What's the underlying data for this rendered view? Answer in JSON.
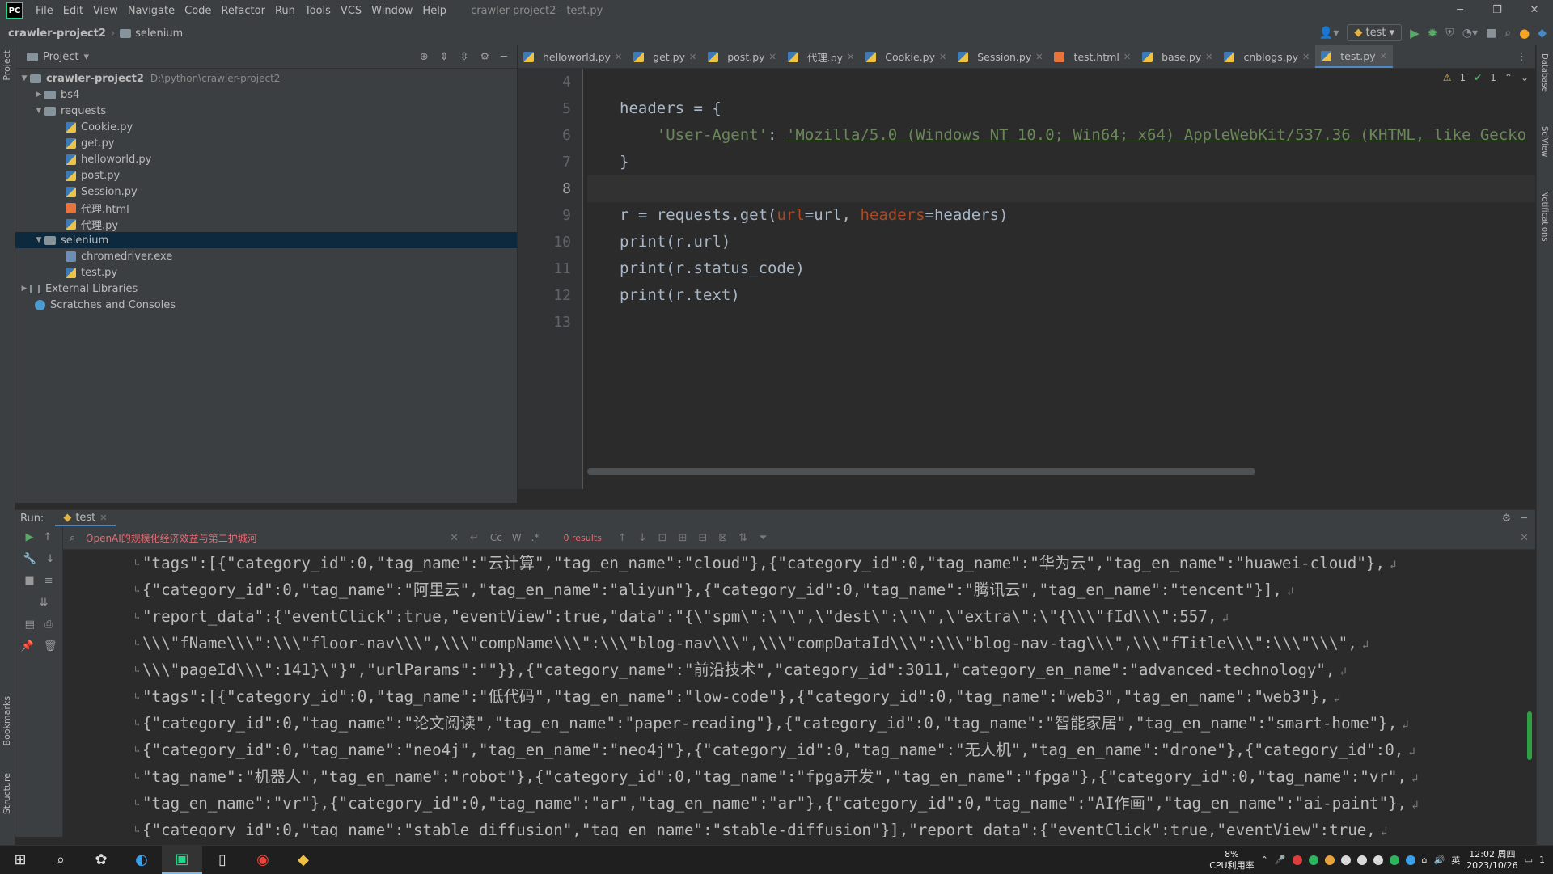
{
  "menubar": {
    "logo": "PC",
    "items": [
      "File",
      "Edit",
      "View",
      "Navigate",
      "Code",
      "Refactor",
      "Run",
      "Tools",
      "VCS",
      "Window",
      "Help"
    ],
    "window_title": "crawler-project2 - test.py"
  },
  "navbar": {
    "project": "crawler-project2",
    "folder": "selenium",
    "run_config": "test"
  },
  "project_panel": {
    "title": "Project",
    "root": "crawler-project2",
    "root_path": "D:\\python\\crawler-project2",
    "bs4": "bs4",
    "requests": "requests",
    "requests_files": [
      "Cookie.py",
      "get.py",
      "helloworld.py",
      "post.py",
      "Session.py",
      "代理.html",
      "代理.py"
    ],
    "selenium": "selenium",
    "selenium_files": [
      "chromedriver.exe",
      "test.py"
    ],
    "external": "External Libraries",
    "scratches": "Scratches and Consoles"
  },
  "tabs": [
    "helloworld.py",
    "get.py",
    "post.py",
    "代理.py",
    "Cookie.py",
    "Session.py",
    "test.html",
    "base.py",
    "cnblogs.py",
    "test.py"
  ],
  "editor": {
    "inspections": {
      "warnings": "1",
      "ok": "1"
    },
    "line_numbers": [
      "4",
      "5",
      "6",
      "7",
      "8",
      "9",
      "10",
      "11",
      "12",
      "13"
    ],
    "line5": "headers = {",
    "line6_key": "'User-Agent'",
    "line6_colon": ": ",
    "line6_val": "'Mozilla/5.0 (Windows NT 10.0; Win64; x64) AppleWebKit/537.36 (KHTML, like Gecko",
    "line7": "}",
    "line9_a": "r = requests.get(",
    "line9_url_kw": "url",
    "line9_b": "=url, ",
    "line9_headers_kw": "headers",
    "line9_c": "=headers)",
    "line10": "print(r.url)",
    "line11": "print(r.status_code)",
    "line12": "print(r.text)"
  },
  "run": {
    "label": "Run:",
    "tab": "test",
    "search_query": "OpenAI的规模化经济效益与第二护城河",
    "search_opts": [
      "Cc",
      "W",
      ".*"
    ],
    "results": "0 results",
    "output": [
      "\"tags\":[{\"category_id\":0,\"tag_name\":\"云计算\",\"tag_en_name\":\"cloud\"},{\"category_id\":0,\"tag_name\":\"华为云\",\"tag_en_name\":\"huawei-cloud\"},",
      "{\"category_id\":0,\"tag_name\":\"阿里云\",\"tag_en_name\":\"aliyun\"},{\"category_id\":0,\"tag_name\":\"腾讯云\",\"tag_en_name\":\"tencent\"}],",
      "\"report_data\":{\"eventClick\":true,\"eventView\":true,\"data\":\"{\\\"spm\\\":\\\"\\\",\\\"dest\\\":\\\"\\\",\\\"extra\\\":\\\"{\\\\\\\"fId\\\\\\\":557,",
      "\\\\\\\"fName\\\\\\\":\\\\\\\"floor-nav\\\\\\\",\\\\\\\"compName\\\\\\\":\\\\\\\"blog-nav\\\\\\\",\\\\\\\"compDataId\\\\\\\":\\\\\\\"blog-nav-tag\\\\\\\",\\\\\\\"fTitle\\\\\\\":\\\\\\\"\\\\\\\",",
      "\\\\\\\"pageId\\\\\\\":141}\\\"}\",\"urlParams\":\"\"}},{\"category_name\":\"前沿技术\",\"category_id\":3011,\"category_en_name\":\"advanced-technology\",",
      "\"tags\":[{\"category_id\":0,\"tag_name\":\"低代码\",\"tag_en_name\":\"low-code\"},{\"category_id\":0,\"tag_name\":\"web3\",\"tag_en_name\":\"web3\"},",
      "{\"category_id\":0,\"tag_name\":\"论文阅读\",\"tag_en_name\":\"paper-reading\"},{\"category_id\":0,\"tag_name\":\"智能家居\",\"tag_en_name\":\"smart-home\"},",
      "{\"category_id\":0,\"tag_name\":\"neo4j\",\"tag_en_name\":\"neo4j\"},{\"category_id\":0,\"tag_name\":\"无人机\",\"tag_en_name\":\"drone\"},{\"category_id\":0,",
      "\"tag_name\":\"机器人\",\"tag_en_name\":\"robot\"},{\"category_id\":0,\"tag_name\":\"fpga开发\",\"tag_en_name\":\"fpga\"},{\"category_id\":0,\"tag_name\":\"vr\",",
      "\"tag_en_name\":\"vr\"},{\"category_id\":0,\"tag_name\":\"ar\",\"tag_en_name\":\"ar\"},{\"category_id\":0,\"tag_name\":\"AI作画\",\"tag_en_name\":\"ai-paint\"},",
      "{\"category_id\":0,\"tag_name\":\"stable diffusion\",\"tag_en_name\":\"stable-diffusion\"}],\"report_data\":{\"eventClick\":true,\"eventView\":true,"
    ]
  },
  "tool_windows": {
    "left": [
      "Project",
      "Bookmarks",
      "Structure"
    ],
    "right": [
      "Database",
      "SciView",
      "Notifications"
    ]
  },
  "taskbar": {
    "cpu_percent": "8%",
    "cpu_label": "CPU利用率",
    "ime": "英",
    "time": "12:02 周四",
    "date": "2023/10/26",
    "notification_count": "1"
  }
}
